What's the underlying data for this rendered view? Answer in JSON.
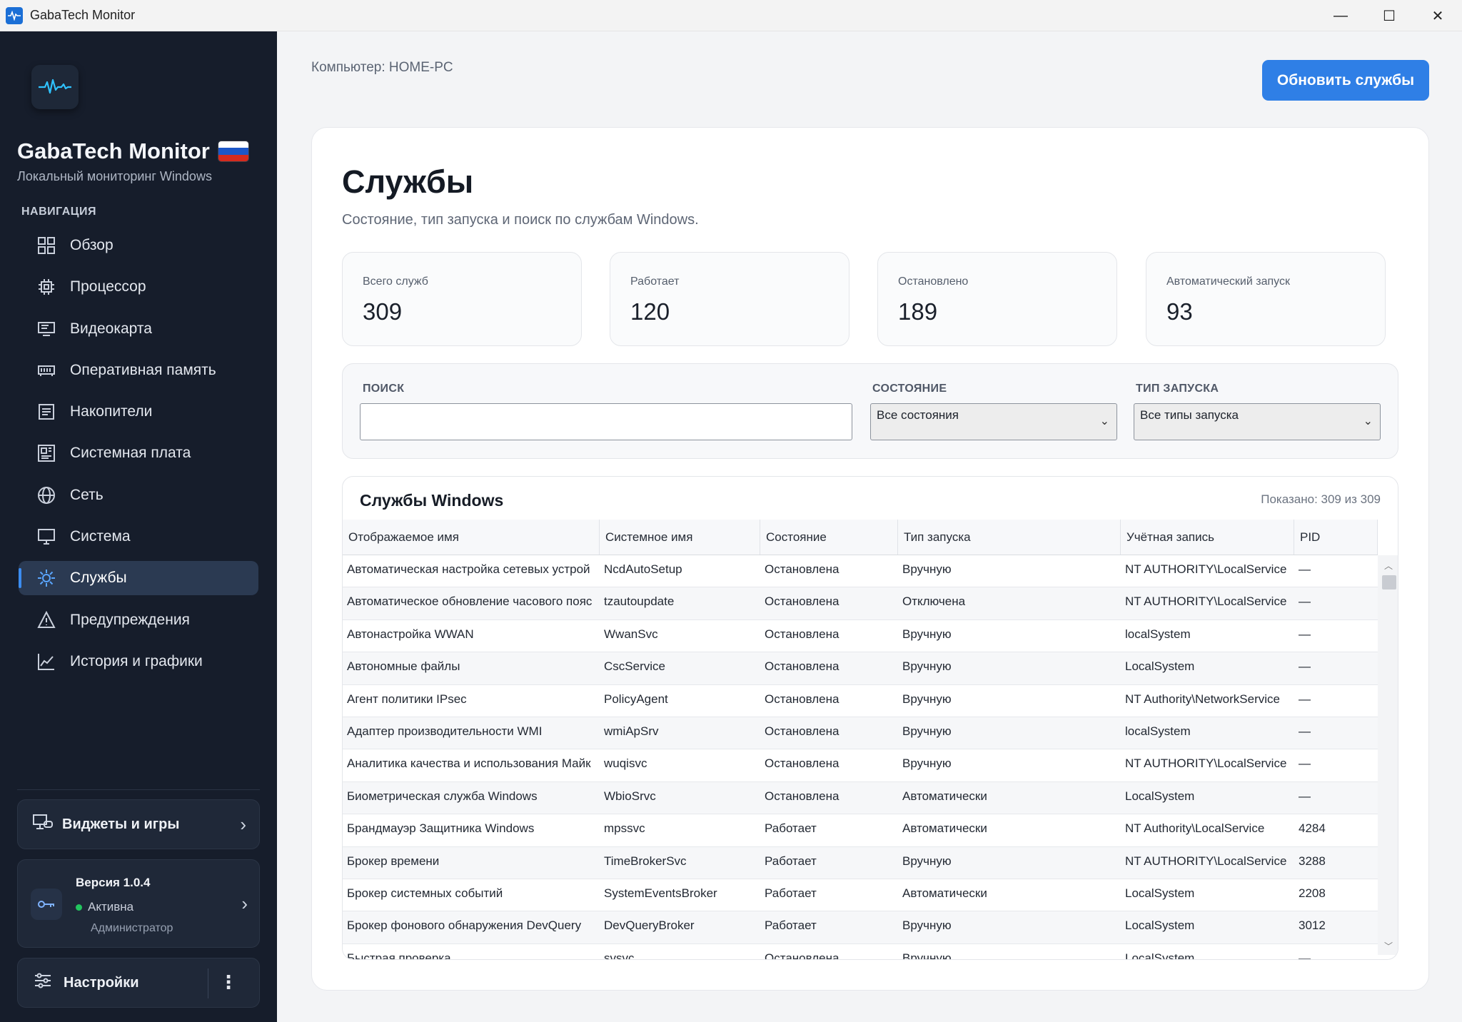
{
  "window": {
    "title": "GabaTech Monitor",
    "controls": {
      "minimize": "—",
      "maximize": "☐",
      "close": "✕"
    }
  },
  "sidebar": {
    "app_name": "GabaTech Monitor",
    "app_subtitle": "Локальный мониторинг Windows",
    "nav_heading": "НАВИГАЦИЯ",
    "items": [
      {
        "label": "Обзор",
        "icon": "grid-icon",
        "active": false
      },
      {
        "label": "Процессор",
        "icon": "cpu-icon",
        "active": false
      },
      {
        "label": "Видеокарта",
        "icon": "gpu-icon",
        "active": false
      },
      {
        "label": "Оперативная память",
        "icon": "memory-icon",
        "active": false
      },
      {
        "label": "Накопители",
        "icon": "storage-icon",
        "active": false
      },
      {
        "label": "Системная плата",
        "icon": "motherboard-icon",
        "active": false
      },
      {
        "label": "Сеть",
        "icon": "globe-icon",
        "active": false
      },
      {
        "label": "Система",
        "icon": "monitor-icon",
        "active": false
      },
      {
        "label": "Службы",
        "icon": "gear-icon",
        "active": true
      },
      {
        "label": "Предупреждения",
        "icon": "warning-icon",
        "active": false
      },
      {
        "label": "История и графики",
        "icon": "chart-icon",
        "active": false
      }
    ],
    "widgets_label": "Виджеты и игры",
    "version": {
      "title": "Версия 1.0.4",
      "status": "Активна",
      "role": "Администратор"
    },
    "settings_label": "Настройки"
  },
  "header": {
    "computer": "Компьютер: HOME-PC",
    "refresh_button": "Обновить службы"
  },
  "page": {
    "title": "Службы",
    "subtitle": "Состояние, тип запуска и поиск по службам Windows."
  },
  "stats": [
    {
      "label": "Всего служб",
      "value": "309"
    },
    {
      "label": "Работает",
      "value": "120"
    },
    {
      "label": "Остановлено",
      "value": "189"
    },
    {
      "label": "Автоматический запуск",
      "value": "93"
    }
  ],
  "filters": {
    "search_label": "ПОИСК",
    "search_value": "",
    "state_label": "СОСТОЯНИЕ",
    "state_value": "Все состояния",
    "startup_label": "ТИП ЗАПУСКА",
    "startup_value": "Все типы запуска"
  },
  "table": {
    "title": "Службы Windows",
    "count": "Показано: 309 из 309",
    "columns": [
      "Отображаемое имя",
      "Системное имя",
      "Состояние",
      "Тип запуска",
      "Учётная запись",
      "PID"
    ],
    "rows": [
      [
        "Автоматическая настройка сетевых устрой",
        "NcdAutoSetup",
        "Остановлена",
        "Вручную",
        "NT AUTHORITY\\LocalService",
        "—"
      ],
      [
        "Автоматическое обновление часового пояс",
        "tzautoupdate",
        "Остановлена",
        "Отключена",
        "NT AUTHORITY\\LocalService",
        "—"
      ],
      [
        "Автонастройка WWAN",
        "WwanSvc",
        "Остановлена",
        "Вручную",
        "localSystem",
        "—"
      ],
      [
        "Автономные файлы",
        "CscService",
        "Остановлена",
        "Вручную",
        "LocalSystem",
        "—"
      ],
      [
        "Агент политики IPsec",
        "PolicyAgent",
        "Остановлена",
        "Вручную",
        "NT Authority\\NetworkService",
        "—"
      ],
      [
        "Адаптер производительности WMI",
        "wmiApSrv",
        "Остановлена",
        "Вручную",
        "localSystem",
        "—"
      ],
      [
        "Аналитика качества и использования Майк",
        "wuqisvc",
        "Остановлена",
        "Вручную",
        "NT AUTHORITY\\LocalService",
        "—"
      ],
      [
        "Биометрическая служба Windows",
        "WbioSrvc",
        "Остановлена",
        "Автоматически",
        "LocalSystem",
        "—"
      ],
      [
        "Брандмауэр Защитника Windows",
        "mpssvc",
        "Работает",
        "Автоматически",
        "NT Authority\\LocalService",
        "4284"
      ],
      [
        "Брокер времени",
        "TimeBrokerSvc",
        "Работает",
        "Вручную",
        "NT AUTHORITY\\LocalService",
        "3288"
      ],
      [
        "Брокер системных событий",
        "SystemEventsBroker",
        "Работает",
        "Автоматически",
        "LocalSystem",
        "2208"
      ],
      [
        "Брокер фонового обнаружения DevQuery",
        "DevQueryBroker",
        "Работает",
        "Вручную",
        "LocalSystem",
        "3012"
      ],
      [
        "Быстрая проверка",
        "svsvc",
        "Остановлена",
        "Вручную",
        "LocalSystem",
        "—"
      ]
    ]
  },
  "colors": {
    "sidebar_bg": "#161d2b",
    "accent": "#2f7fe6",
    "active_nav": "#2b3a52",
    "status_active": "#22c55e"
  }
}
